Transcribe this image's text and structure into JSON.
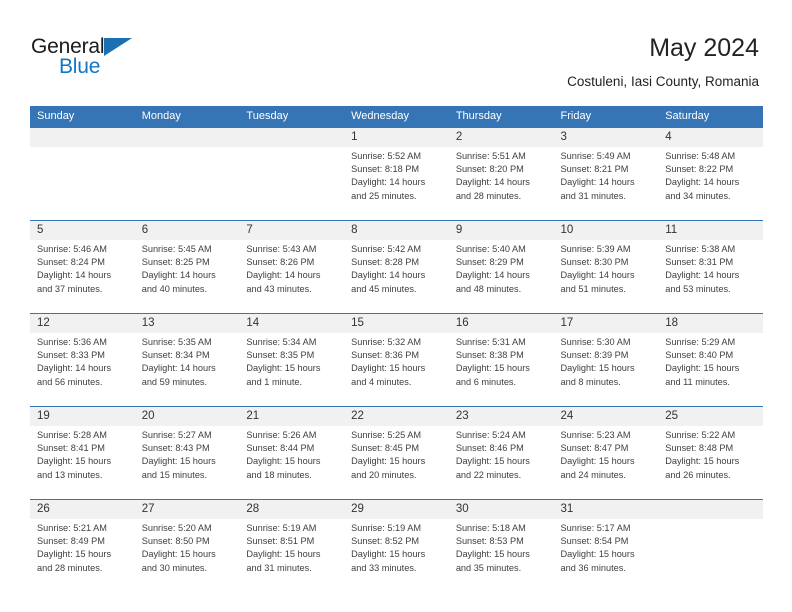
{
  "logo": {
    "text_primary": "General",
    "text_secondary": "Blue",
    "primary_color": "#1b1b1b",
    "secondary_color": "#1277c4",
    "triangle_color": "#1a6fb5"
  },
  "header": {
    "title": "May 2024",
    "subtitle": "Costuleni, Iasi County, Romania"
  },
  "theme": {
    "header_blue": "#3575b5",
    "number_band": "#f1f1f1",
    "text": "#404040"
  },
  "calendar": {
    "weekdays": [
      "Sunday",
      "Monday",
      "Tuesday",
      "Wednesday",
      "Thursday",
      "Friday",
      "Saturday"
    ],
    "weeks": [
      [
        {
          "day": "",
          "lines": []
        },
        {
          "day": "",
          "lines": []
        },
        {
          "day": "",
          "lines": []
        },
        {
          "day": "1",
          "lines": [
            "Sunrise: 5:52 AM",
            "Sunset: 8:18 PM",
            "Daylight: 14 hours",
            "and 25 minutes."
          ]
        },
        {
          "day": "2",
          "lines": [
            "Sunrise: 5:51 AM",
            "Sunset: 8:20 PM",
            "Daylight: 14 hours",
            "and 28 minutes."
          ]
        },
        {
          "day": "3",
          "lines": [
            "Sunrise: 5:49 AM",
            "Sunset: 8:21 PM",
            "Daylight: 14 hours",
            "and 31 minutes."
          ]
        },
        {
          "day": "4",
          "lines": [
            "Sunrise: 5:48 AM",
            "Sunset: 8:22 PM",
            "Daylight: 14 hours",
            "and 34 minutes."
          ]
        }
      ],
      [
        {
          "day": "5",
          "lines": [
            "Sunrise: 5:46 AM",
            "Sunset: 8:24 PM",
            "Daylight: 14 hours",
            "and 37 minutes."
          ]
        },
        {
          "day": "6",
          "lines": [
            "Sunrise: 5:45 AM",
            "Sunset: 8:25 PM",
            "Daylight: 14 hours",
            "and 40 minutes."
          ]
        },
        {
          "day": "7",
          "lines": [
            "Sunrise: 5:43 AM",
            "Sunset: 8:26 PM",
            "Daylight: 14 hours",
            "and 43 minutes."
          ]
        },
        {
          "day": "8",
          "lines": [
            "Sunrise: 5:42 AM",
            "Sunset: 8:28 PM",
            "Daylight: 14 hours",
            "and 45 minutes."
          ]
        },
        {
          "day": "9",
          "lines": [
            "Sunrise: 5:40 AM",
            "Sunset: 8:29 PM",
            "Daylight: 14 hours",
            "and 48 minutes."
          ]
        },
        {
          "day": "10",
          "lines": [
            "Sunrise: 5:39 AM",
            "Sunset: 8:30 PM",
            "Daylight: 14 hours",
            "and 51 minutes."
          ]
        },
        {
          "day": "11",
          "lines": [
            "Sunrise: 5:38 AM",
            "Sunset: 8:31 PM",
            "Daylight: 14 hours",
            "and 53 minutes."
          ]
        }
      ],
      [
        {
          "day": "12",
          "lines": [
            "Sunrise: 5:36 AM",
            "Sunset: 8:33 PM",
            "Daylight: 14 hours",
            "and 56 minutes."
          ]
        },
        {
          "day": "13",
          "lines": [
            "Sunrise: 5:35 AM",
            "Sunset: 8:34 PM",
            "Daylight: 14 hours",
            "and 59 minutes."
          ]
        },
        {
          "day": "14",
          "lines": [
            "Sunrise: 5:34 AM",
            "Sunset: 8:35 PM",
            "Daylight: 15 hours",
            "and 1 minute."
          ]
        },
        {
          "day": "15",
          "lines": [
            "Sunrise: 5:32 AM",
            "Sunset: 8:36 PM",
            "Daylight: 15 hours",
            "and 4 minutes."
          ]
        },
        {
          "day": "16",
          "lines": [
            "Sunrise: 5:31 AM",
            "Sunset: 8:38 PM",
            "Daylight: 15 hours",
            "and 6 minutes."
          ]
        },
        {
          "day": "17",
          "lines": [
            "Sunrise: 5:30 AM",
            "Sunset: 8:39 PM",
            "Daylight: 15 hours",
            "and 8 minutes."
          ]
        },
        {
          "day": "18",
          "lines": [
            "Sunrise: 5:29 AM",
            "Sunset: 8:40 PM",
            "Daylight: 15 hours",
            "and 11 minutes."
          ]
        }
      ],
      [
        {
          "day": "19",
          "lines": [
            "Sunrise: 5:28 AM",
            "Sunset: 8:41 PM",
            "Daylight: 15 hours",
            "and 13 minutes."
          ]
        },
        {
          "day": "20",
          "lines": [
            "Sunrise: 5:27 AM",
            "Sunset: 8:43 PM",
            "Daylight: 15 hours",
            "and 15 minutes."
          ]
        },
        {
          "day": "21",
          "lines": [
            "Sunrise: 5:26 AM",
            "Sunset: 8:44 PM",
            "Daylight: 15 hours",
            "and 18 minutes."
          ]
        },
        {
          "day": "22",
          "lines": [
            "Sunrise: 5:25 AM",
            "Sunset: 8:45 PM",
            "Daylight: 15 hours",
            "and 20 minutes."
          ]
        },
        {
          "day": "23",
          "lines": [
            "Sunrise: 5:24 AM",
            "Sunset: 8:46 PM",
            "Daylight: 15 hours",
            "and 22 minutes."
          ]
        },
        {
          "day": "24",
          "lines": [
            "Sunrise: 5:23 AM",
            "Sunset: 8:47 PM",
            "Daylight: 15 hours",
            "and 24 minutes."
          ]
        },
        {
          "day": "25",
          "lines": [
            "Sunrise: 5:22 AM",
            "Sunset: 8:48 PM",
            "Daylight: 15 hours",
            "and 26 minutes."
          ]
        }
      ],
      [
        {
          "day": "26",
          "lines": [
            "Sunrise: 5:21 AM",
            "Sunset: 8:49 PM",
            "Daylight: 15 hours",
            "and 28 minutes."
          ]
        },
        {
          "day": "27",
          "lines": [
            "Sunrise: 5:20 AM",
            "Sunset: 8:50 PM",
            "Daylight: 15 hours",
            "and 30 minutes."
          ]
        },
        {
          "day": "28",
          "lines": [
            "Sunrise: 5:19 AM",
            "Sunset: 8:51 PM",
            "Daylight: 15 hours",
            "and 31 minutes."
          ]
        },
        {
          "day": "29",
          "lines": [
            "Sunrise: 5:19 AM",
            "Sunset: 8:52 PM",
            "Daylight: 15 hours",
            "and 33 minutes."
          ]
        },
        {
          "day": "30",
          "lines": [
            "Sunrise: 5:18 AM",
            "Sunset: 8:53 PM",
            "Daylight: 15 hours",
            "and 35 minutes."
          ]
        },
        {
          "day": "31",
          "lines": [
            "Sunrise: 5:17 AM",
            "Sunset: 8:54 PM",
            "Daylight: 15 hours",
            "and 36 minutes."
          ]
        },
        {
          "day": "",
          "lines": []
        }
      ]
    ]
  }
}
